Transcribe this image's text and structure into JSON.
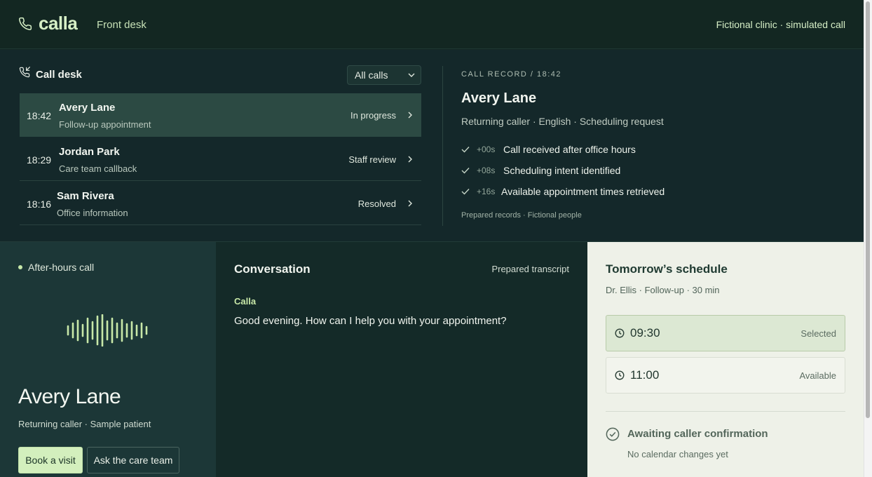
{
  "header": {
    "logo": "calla",
    "nav_label": "Front desk",
    "note": "Fictional clinic · simulated call"
  },
  "desk": {
    "title": "Call desk",
    "filter": "All calls",
    "calls": [
      {
        "time": "18:42",
        "name": "Avery Lane",
        "subject": "Follow-up appointment",
        "status": "In progress"
      },
      {
        "time": "18:29",
        "name": "Jordan Park",
        "subject": "Care team callback",
        "status": "Staff review"
      },
      {
        "time": "18:16",
        "name": "Sam Rivera",
        "subject": "Office information",
        "status": "Resolved"
      }
    ]
  },
  "record": {
    "label": "CALL RECORD / 18:42",
    "name": "Avery Lane",
    "meta": "Returning caller · English · Scheduling request",
    "events": [
      {
        "offset": "+00s",
        "text": "Call received after office hours"
      },
      {
        "offset": "+08s",
        "text": "Scheduling intent identified"
      },
      {
        "offset": "+16s",
        "text": "Available appointment times retrieved"
      }
    ],
    "footer": "Prepared records · Fictional people"
  },
  "voice": {
    "status": "After-hours call",
    "name": "Avery Lane",
    "subtitle": "Returning caller · Sample patient",
    "primary_button": "Book a visit",
    "secondary_button": "Ask the care team"
  },
  "conversation": {
    "title": "Conversation",
    "note": "Prepared transcript",
    "speaker": "Calla",
    "utterance": "Good evening. How can I help you with your appointment?"
  },
  "schedule": {
    "title": "Tomorrow’s schedule",
    "subtitle": "Dr. Ellis · Follow-up · 30 min",
    "slots": [
      {
        "time": "09:30",
        "state": "Selected"
      },
      {
        "time": "11:00",
        "state": "Available"
      }
    ],
    "confirm_title": "Awaiting caller confirmation",
    "confirm_sub": "No calendar changes yet"
  },
  "colors": {
    "accent": "#d3efbd",
    "background": "#142825",
    "schedule_bg": "#eef1e8"
  },
  "icons": {
    "logo": "phone-icon",
    "desk": "phone-incoming-icon",
    "check": "check-icon",
    "clock": "clock-icon",
    "confirm": "circle-check-icon",
    "wave": "audio-wave-icon"
  }
}
